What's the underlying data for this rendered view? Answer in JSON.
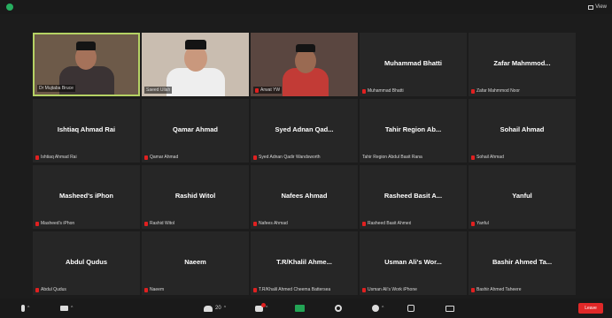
{
  "topbar": {
    "view_label": "View"
  },
  "participants": [
    {
      "name": "",
      "label": "Dr Mujtaba Bruce",
      "video": true,
      "muted": false
    },
    {
      "name": "",
      "label": "Saeed Ullah",
      "video": true,
      "muted": false
    },
    {
      "name": "",
      "label": "Arwat YW",
      "video": true,
      "muted": true
    },
    {
      "name": "Muhammad Bhatti",
      "label": "Muhammad Bhatti",
      "video": false,
      "muted": true
    },
    {
      "name": "Zafar Mahmmod...",
      "label": "Zafar Mahmmod Noor",
      "video": false,
      "muted": true
    },
    {
      "name": "Ishtiaq Ahmad Rai",
      "label": "Ishtiaq Ahmad Rai",
      "video": false,
      "muted": true
    },
    {
      "name": "Qamar Ahmad",
      "label": "Qamar Ahmad",
      "video": false,
      "muted": true
    },
    {
      "name": "Syed Adnan Qad...",
      "label": "Syed Adnan Qadir Wandsworth",
      "video": false,
      "muted": true
    },
    {
      "name": "Tahir Region Ab...",
      "label": "Tahir Region Abdul Basit Rana",
      "video": false,
      "muted": false
    },
    {
      "name": "Sohail Ahmad",
      "label": "Sohail Ahmad",
      "video": false,
      "muted": true
    },
    {
      "name": "Masheed's iPhon",
      "label": "Masheed's iPhon",
      "video": false,
      "muted": true
    },
    {
      "name": "Rashid Witol",
      "label": "Rashid Witol",
      "video": false,
      "muted": true
    },
    {
      "name": "Nafees Ahmad",
      "label": "Nafees Ahmad",
      "video": false,
      "muted": true
    },
    {
      "name": "Rasheed Basit A...",
      "label": "Rasheed Basit Ahmed",
      "video": false,
      "muted": true
    },
    {
      "name": "Yanful",
      "label": "Yanful",
      "video": false,
      "muted": true
    },
    {
      "name": "Abdul Qudus",
      "label": "Abdul Qudus",
      "video": false,
      "muted": true
    },
    {
      "name": "Naeem",
      "label": "Naeem",
      "video": false,
      "muted": true
    },
    {
      "name": "T.R/Khalil Ahme...",
      "label": "T.R/Khalil Ahmed Cheema Battersea",
      "video": false,
      "muted": true
    },
    {
      "name": "Usman Ali's Wor...",
      "label": "Usman Ali's Work iPhone",
      "video": false,
      "muted": true
    },
    {
      "name": "Bashir Ahmed Ta...",
      "label": "Bashir Ahmed Taheere",
      "video": false,
      "muted": true
    }
  ],
  "toolbar": {
    "participants_count": "20",
    "leave_label": "Leave"
  },
  "colors": {
    "active_speaker_border": "#b5d264",
    "mute_icon": "#e02020",
    "share_button": "#23a455",
    "leave_button": "#e02828"
  }
}
